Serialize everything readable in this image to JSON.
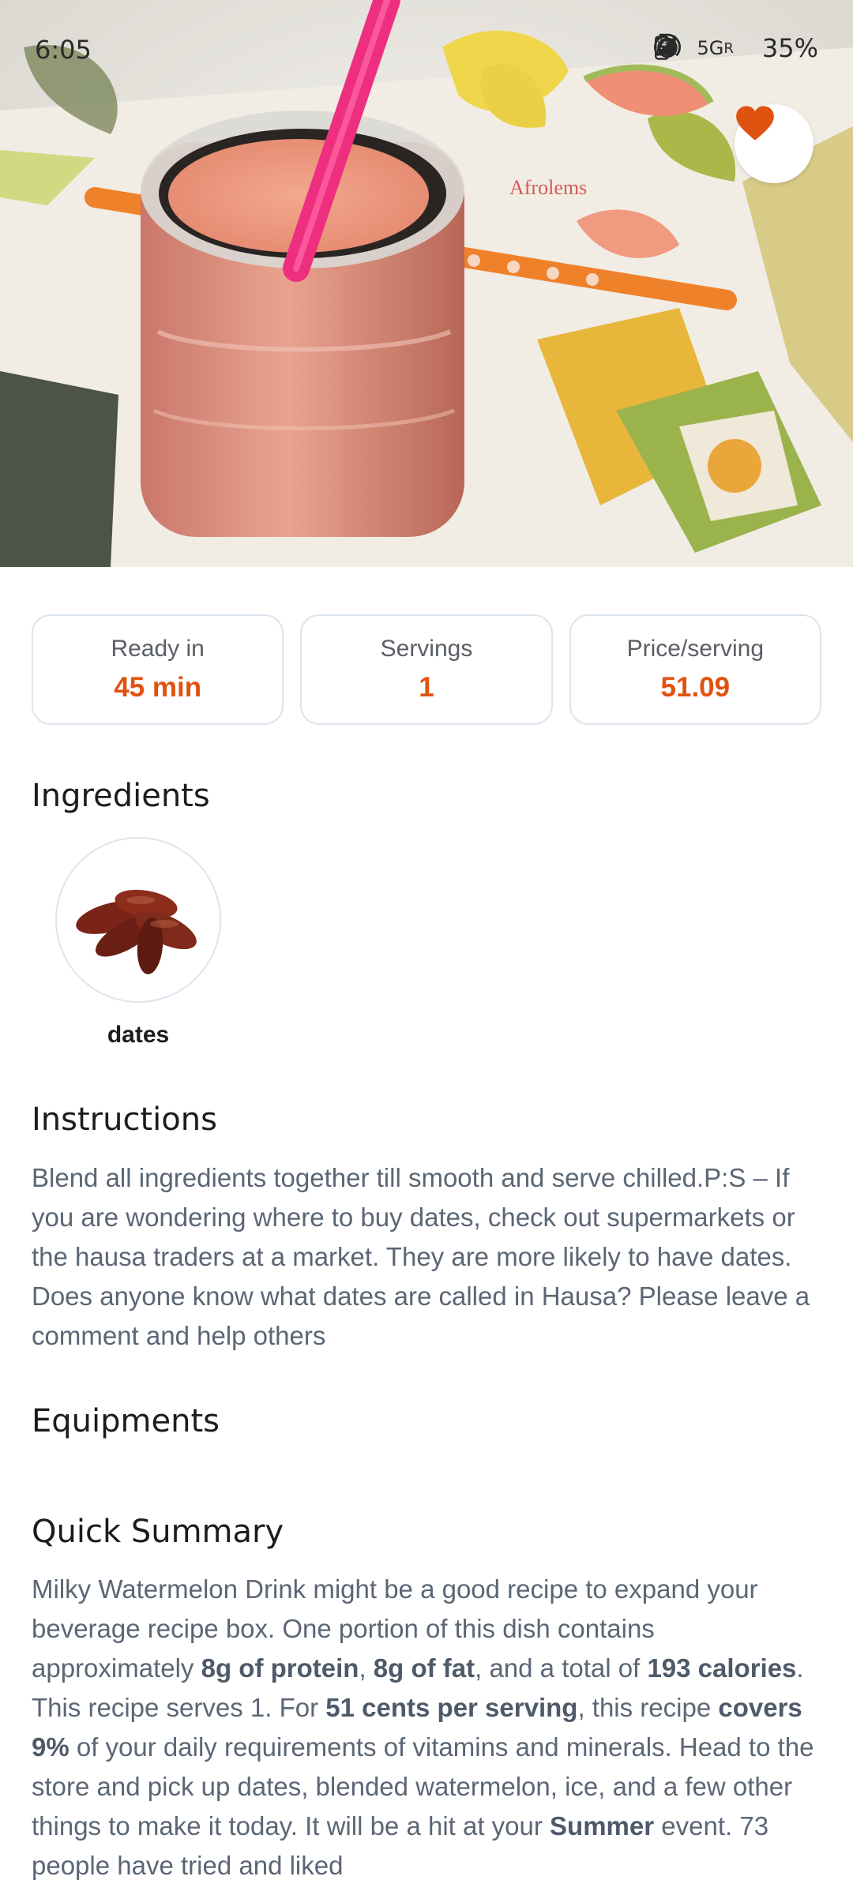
{
  "status_bar": {
    "time": "6:05",
    "network_label": "5G",
    "roaming": "R",
    "battery": "35%"
  },
  "hero": {
    "image_desc": "smoothie-jar-photo",
    "watermark": "Afrolems",
    "favorite_icon": "heart-icon",
    "accent": "#e0520f"
  },
  "stats": [
    {
      "label": "Ready in",
      "value": "45 min"
    },
    {
      "label": "Servings",
      "value": "1"
    },
    {
      "label": "Price/serving",
      "value": "51.09"
    }
  ],
  "ingredients": {
    "title": "Ingredients",
    "items": [
      {
        "name": "dates"
      }
    ]
  },
  "instructions": {
    "title": "Instructions",
    "text": "Blend all ingredients together till smooth and serve chilled.P:S – If you are wondering where to buy dates, check out supermarkets or the hausa traders at a market. They are more likely to have dates. Does anyone know what dates are called in Hausa? Please leave a comment and help others"
  },
  "equipments": {
    "title": "Equipments"
  },
  "summary": {
    "title": "Quick Summary",
    "p1": "Milky Watermelon Drink might be a good recipe to expand your beverage recipe box. One portion of this dish contains approximately ",
    "b1": "8g of protein",
    "p2": ", ",
    "b2": "8g of fat",
    "p3": ", and a total of ",
    "b3": "193 calories",
    "p4": ". This recipe serves 1. For ",
    "b4": "51 cents per serving",
    "p5": ", this recipe ",
    "b5": "covers 9%",
    "p6": " of your daily requirements of vitamins and minerals. Head to the store and pick up dates, blended watermelon, ice, and a few other things to make it today. It will be a hit at your ",
    "b6": "Summer",
    "p7": " event. 73 people have tried and liked"
  }
}
